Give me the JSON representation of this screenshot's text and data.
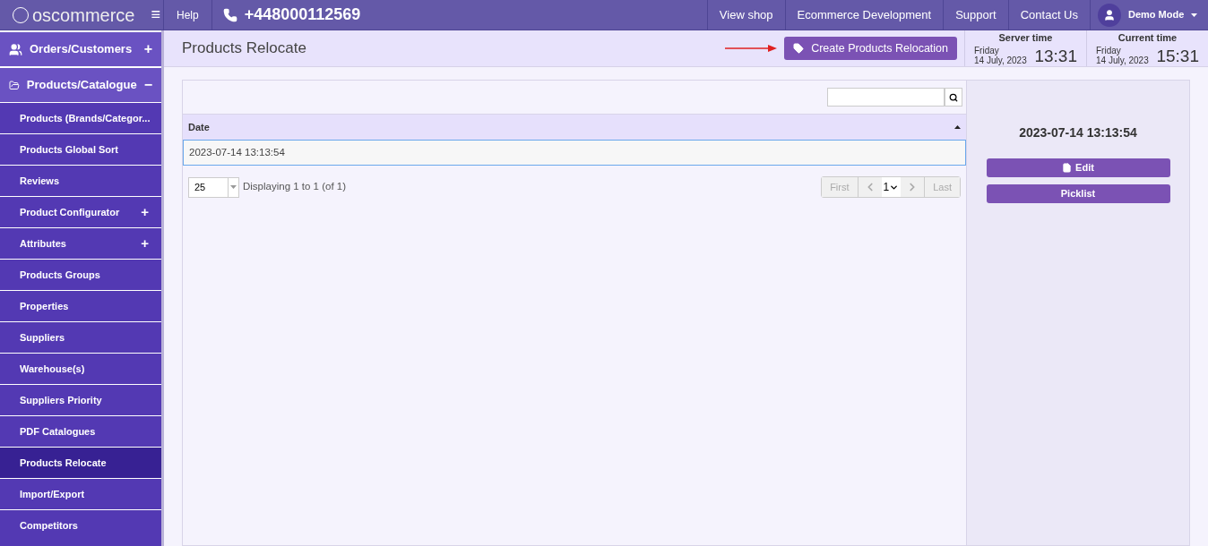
{
  "topbar": {
    "logo": "oscommerce",
    "menu_icon": "≡",
    "help": "Help",
    "phone": "+448000112569",
    "links": [
      "View shop",
      "Ecommerce Development",
      "Support",
      "Contact Us"
    ],
    "user": "Demo Mode"
  },
  "sidebar": {
    "groups": [
      {
        "label": "Orders/Customers",
        "toggle": "+"
      },
      {
        "label": "Products/Catalogue",
        "toggle": "−",
        "items": [
          {
            "label": "Products (Brands/Categor...",
            "selected": false
          },
          {
            "label": "Products Global Sort",
            "selected": false
          },
          {
            "label": "Reviews",
            "selected": false
          },
          {
            "label": "Product Configurator",
            "toggle": "+",
            "selected": false
          },
          {
            "label": "Attributes",
            "toggle": "+",
            "selected": false
          },
          {
            "label": "Products Groups",
            "selected": false
          },
          {
            "label": "Properties",
            "selected": false
          },
          {
            "label": "Suppliers",
            "selected": false
          },
          {
            "label": "Warehouse(s)",
            "selected": false
          },
          {
            "label": "Suppliers Priority",
            "selected": false
          },
          {
            "label": "PDF Catalogues",
            "selected": false
          },
          {
            "label": "Products Relocate",
            "selected": true
          },
          {
            "label": "Import/Export",
            "selected": false
          },
          {
            "label": "Competitors",
            "selected": false
          }
        ]
      }
    ]
  },
  "header": {
    "title": "Products Relocate",
    "create_button": "Create Products Relocation",
    "clocks": [
      {
        "label": "Server time",
        "day": "Friday",
        "date": "14 July, 2023",
        "time": "13:31"
      },
      {
        "label": "Current time",
        "day": "Friday",
        "date": "14 July, 2023",
        "time": "15:31"
      }
    ]
  },
  "table": {
    "columns": [
      "Date"
    ],
    "rows": [
      {
        "cells": [
          "2023-07-14 13:13:54"
        ],
        "selected": true
      }
    ]
  },
  "pagination": {
    "per_page": "25",
    "summary": "Displaying 1 to 1 (of 1)",
    "first": "First",
    "page": "1",
    "last": "Last"
  },
  "details": {
    "title": "2023-07-14 13:13:54",
    "buttons": [
      {
        "label": "Edit",
        "kind": "edit"
      },
      {
        "label": "Picklist",
        "kind": "plain"
      }
    ]
  }
}
